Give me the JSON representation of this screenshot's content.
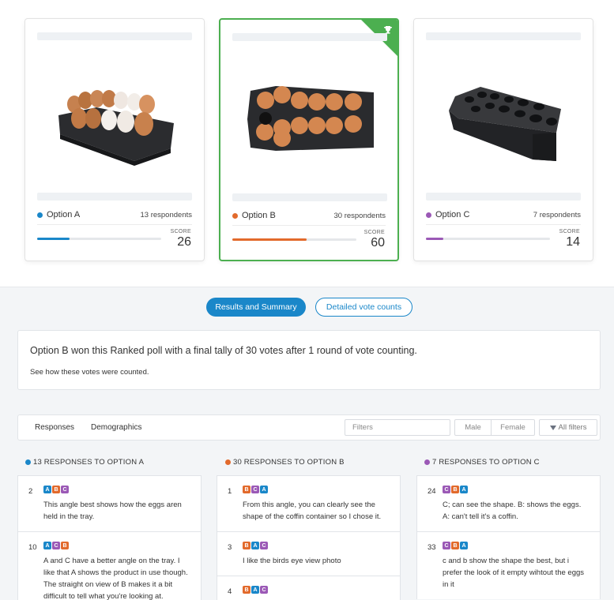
{
  "options": [
    {
      "name": "Option A",
      "respondents": "13 respondents",
      "score_label": "SCORE",
      "score": "26",
      "color": "#1a87c9",
      "fill": 0.26,
      "winner": false
    },
    {
      "name": "Option B",
      "respondents": "30 respondents",
      "score_label": "SCORE",
      "score": "60",
      "color": "#e26a2c",
      "fill": 0.6,
      "winner": true
    },
    {
      "name": "Option C",
      "respondents": "7 respondents",
      "score_label": "SCORE",
      "score": "14",
      "color": "#9b59b6",
      "fill": 0.14,
      "winner": false
    }
  ],
  "tabs": {
    "results": "Results and Summary",
    "details": "Detailed vote counts"
  },
  "summary": {
    "main": "Option B won this Ranked poll with a final tally of 30 votes after 1 round of vote counting.",
    "sub": "See how these votes were counted."
  },
  "filters": {
    "responses_tab": "Responses",
    "demographics_tab": "Demographics",
    "filter_placeholder": "Filters",
    "male": "Male",
    "female": "Female",
    "all_filters": "All filters"
  },
  "columns": [
    {
      "heading": "13 RESPONSES TO OPTION A",
      "color": "#1a87c9",
      "items": [
        {
          "num": "2",
          "ranks": [
            "A",
            "B",
            "C"
          ],
          "text": "This angle best shows how the eggs aren held in the tray."
        },
        {
          "num": "10",
          "ranks": [
            "A",
            "C",
            "B"
          ],
          "text": "A and C have a better angle on the tray. I like that A shows the product in use though. The straight on view of B makes it a bit difficult to tell what you're looking at."
        }
      ]
    },
    {
      "heading": "30 RESPONSES TO OPTION B",
      "color": "#e26a2c",
      "items": [
        {
          "num": "1",
          "ranks": [
            "B",
            "C",
            "A"
          ],
          "text": "From this angle, you can clearly see the shape of the coffin container so I chose it."
        },
        {
          "num": "3",
          "ranks": [
            "B",
            "A",
            "C"
          ],
          "text": "I like the birds eye view photo"
        },
        {
          "num": "4",
          "ranks": [
            "B",
            "A",
            "C"
          ],
          "text": ""
        }
      ]
    },
    {
      "heading": "7 RESPONSES TO OPTION C",
      "color": "#9b59b6",
      "items": [
        {
          "num": "24",
          "ranks": [
            "C",
            "B",
            "A"
          ],
          "text": "C; can see the shape. B: shows the eggs. A: can't tell it's a coffin."
        },
        {
          "num": "33",
          "ranks": [
            "C",
            "B",
            "A"
          ],
          "text": "c and b show the shape the best, but i prefer the look of it empty wihtout the eggs in it"
        }
      ]
    }
  ]
}
